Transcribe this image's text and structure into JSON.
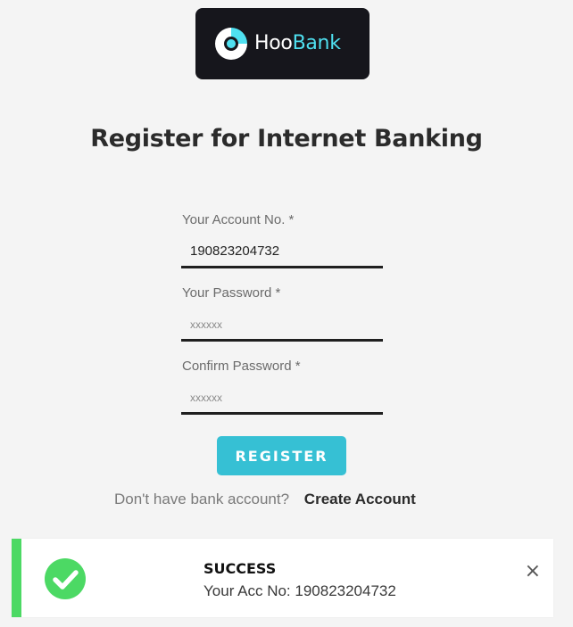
{
  "logo": {
    "text_white": "Hoo",
    "text_accent": "Bank",
    "icon": "hoobank-logo-icon",
    "accent_color": "#4fe0f0"
  },
  "page_title": "Register for Internet Banking",
  "form": {
    "account_no": {
      "label": "Your Account No. *",
      "value": "190823204732",
      "placeholder": ""
    },
    "password": {
      "label": "Your Password *",
      "value": "",
      "placeholder": "xxxxxx"
    },
    "confirm_password": {
      "label": "Confirm Password *",
      "value": "",
      "placeholder": "xxxxxx"
    },
    "register_label": "REGISTER",
    "button_color": "#36c0d4"
  },
  "signup": {
    "question": "Don't have bank account?",
    "link_label": "Create Account"
  },
  "toast": {
    "title": "SUCCESS",
    "message": "Your Acc No: 190823204732",
    "icon": "check-circle-icon",
    "close_icon": "close-icon",
    "close_glyph": "×",
    "status_color": "#4cd964"
  }
}
